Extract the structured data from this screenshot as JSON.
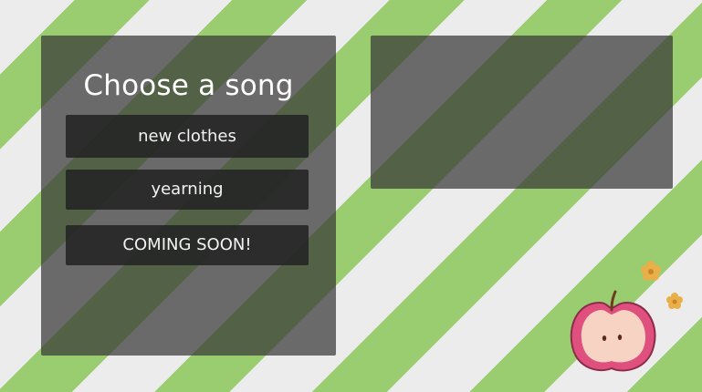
{
  "song_menu": {
    "title": "Choose a song",
    "songs": [
      {
        "label": "new clothes"
      },
      {
        "label": "yearning"
      },
      {
        "label": "COMING SOON!"
      }
    ]
  },
  "decoration": {
    "icon": "apple-icon",
    "flower_icon": "flower-icon"
  },
  "colors": {
    "stripe_green": "#9acd70",
    "stripe_white": "#ececec",
    "panel": "#383838",
    "button": "#222222",
    "text": "#ffffff"
  }
}
